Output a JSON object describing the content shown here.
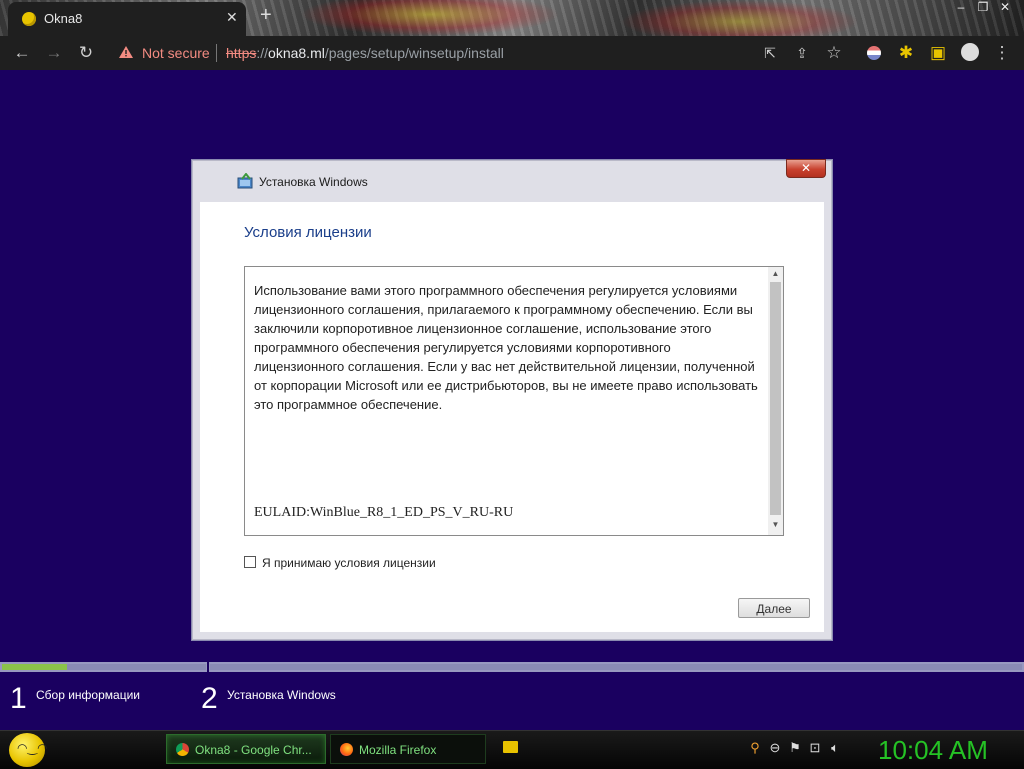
{
  "browser": {
    "tab_title": "Okna8",
    "new_tab": "+",
    "not_secure": "Not secure",
    "url_scheme": "https",
    "url_sep": "://",
    "url_host": "okna8.ml",
    "url_path": "/pages/setup/winsetup/install"
  },
  "setup": {
    "window_title": "Установка Windows",
    "heading": "Условия лицензии",
    "eula_text": "Использование вами этого программного обеспечения регулируется условиями лицензионного соглашения, прилагаемого к программному обеспечению. Если вы заключили корпоротивное лицензионное соглашение, использование этого программного обеспечения регулируется условиями корпоротивного лицензионного соглашения. Если у вас нет действительной лицензии, полученной от корпорации Microsoft или ее дистрибьюторов, вы не имеете право использовать это программное обеспечение.",
    "eula_id": "EULAID:WinBlue_R8_1_ED_PS_V_RU-RU",
    "accept_label": "Я принимаю условия лицензии",
    "accept_checked": false,
    "next_button": "Далее",
    "close_glyph": "✕"
  },
  "steps": [
    {
      "number": "1",
      "label": "Сбор информации",
      "progress": 0.32
    },
    {
      "number": "2",
      "label": "Установка Windows",
      "progress": 0
    }
  ],
  "taskbar": {
    "tasks": [
      {
        "label": "Okna8 - Google Chr...",
        "icon": "chrome-icon"
      },
      {
        "label": "Mozilla Firefox",
        "icon": "firefox-icon"
      }
    ],
    "clock": "10:04 AM"
  },
  "colors": {
    "page_background": "#1a0060",
    "heading_blue": "#1a3e8a",
    "progress_green": "#8bc34a",
    "clock_green": "#25c225"
  }
}
